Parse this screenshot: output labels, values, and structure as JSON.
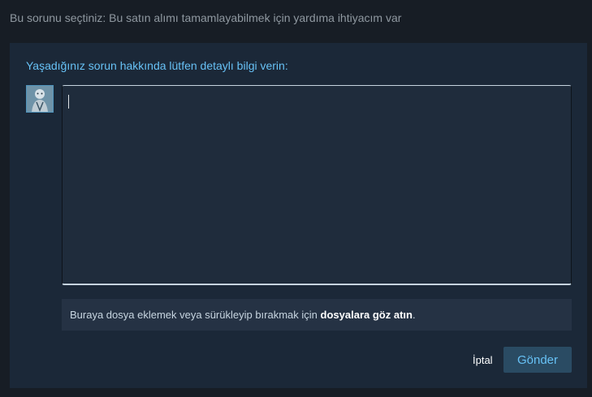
{
  "header": {
    "selected_issue_text": "Bu sorunu seçtiniz: Bu satın alımı tamamlayabilmek için yardıma ihtiyacım var"
  },
  "form": {
    "prompt": "Yaşadığınız sorun hakkında lütfen detaylı bilgi verin:",
    "textarea_value": "",
    "attachments": {
      "text_before": "Buraya dosya eklemek veya sürükleyip bırakmak için",
      "browse_link": "dosyalara göz atın",
      "text_after": "."
    },
    "cancel_label": "İptal",
    "send_label": "Gönder"
  },
  "colors": {
    "page_bg": "#171d25",
    "panel_bg": "#1b2838",
    "accent": "#67c1f5",
    "button_bg": "#2a4b63"
  },
  "icons": {
    "avatar": "user-avatar"
  }
}
